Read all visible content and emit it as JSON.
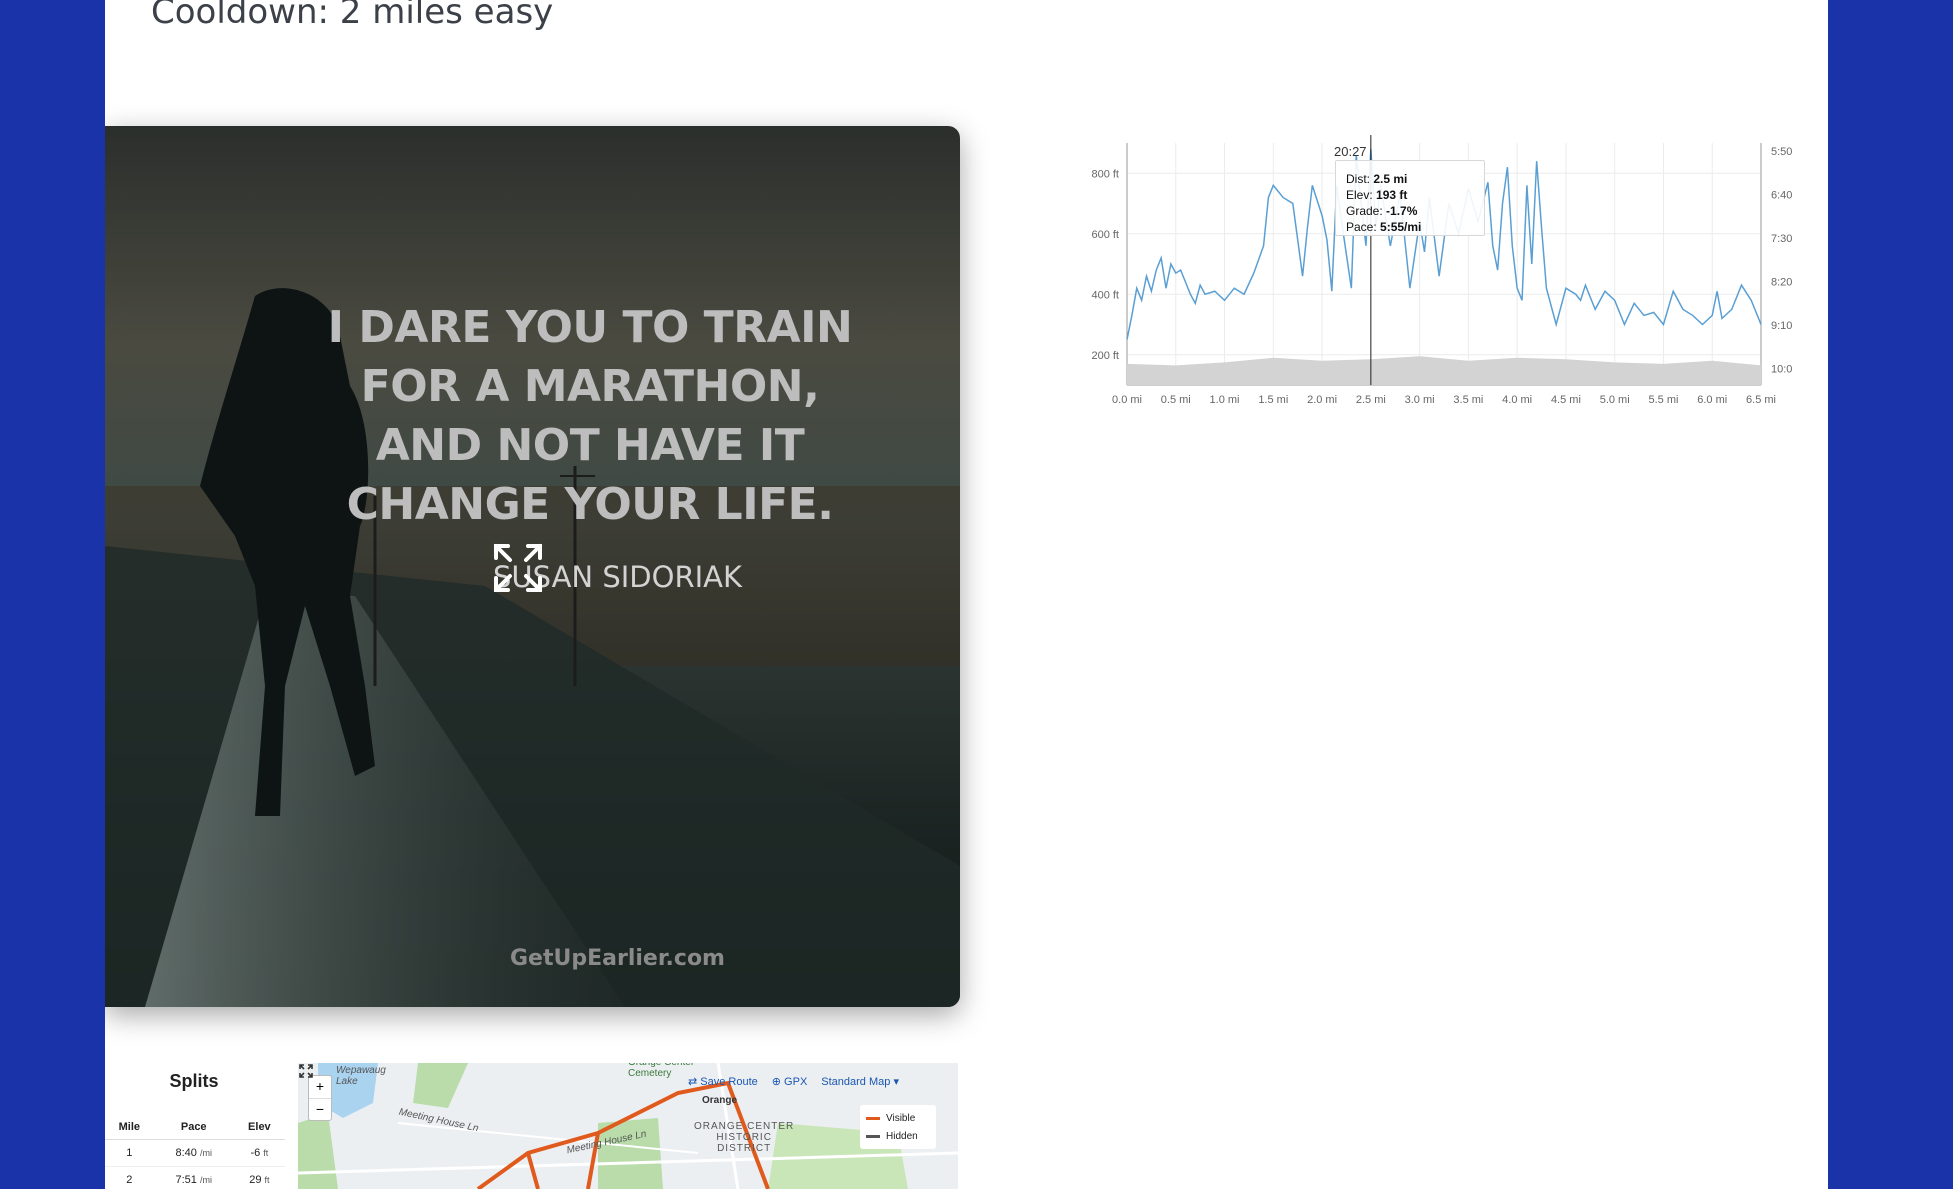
{
  "workout": {
    "cooldown": "Cooldown: 2 miles easy"
  },
  "poster": {
    "quote": "I DARE YOU TO TRAIN\nFOR A MARATHON,\nAND NOT HAVE IT\nCHANGE YOUR LIFE.",
    "author": "SUSAN SIDORIAK",
    "site": "GetUpEarlier.com",
    "expand_icon": "expand-arrows-icon"
  },
  "chart_data": {
    "type": "line",
    "xlabel": "",
    "ylabel": "",
    "x_ticks": [
      "0.0 mi",
      "0.5 mi",
      "1.0 mi",
      "1.5 mi",
      "2.0 mi",
      "2.5 mi",
      "3.0 mi",
      "3.5 mi",
      "4.0 mi",
      "4.5 mi",
      "5.0 mi",
      "5.5 mi",
      "6.0 mi",
      "6.5 mi"
    ],
    "y_ticks_left": [
      "200 ft",
      "400 ft",
      "600 ft",
      "800 ft"
    ],
    "y_ticks_right": [
      "5:50",
      "6:40",
      "7:30",
      "8:20",
      "9:10",
      "10:0"
    ],
    "xlim": [
      0,
      6.5
    ],
    "ylim": [
      100,
      900
    ],
    "grid": true,
    "series": [
      {
        "type": "line",
        "color": "#5a9fd4",
        "x": [
          0,
          0.05,
          0.1,
          0.15,
          0.2,
          0.25,
          0.3,
          0.35,
          0.4,
          0.45,
          0.5,
          0.55,
          0.6,
          0.65,
          0.7,
          0.75,
          0.8,
          0.9,
          1.0,
          1.1,
          1.2,
          1.3,
          1.4,
          1.45,
          1.5,
          1.55,
          1.6,
          1.7,
          1.8,
          1.85,
          1.9,
          2.0,
          2.05,
          2.1,
          2.15,
          2.2,
          2.3,
          2.35,
          2.4,
          2.45,
          2.5,
          2.55,
          2.6,
          2.7,
          2.8,
          2.9,
          3.0,
          3.05,
          3.1,
          3.2,
          3.3,
          3.4,
          3.5,
          3.6,
          3.7,
          3.75,
          3.8,
          3.85,
          3.9,
          3.95,
          4.0,
          4.05,
          4.1,
          4.15,
          4.2,
          4.25,
          4.3,
          4.4,
          4.5,
          4.6,
          4.65,
          4.7,
          4.8,
          4.9,
          5.0,
          5.1,
          5.2,
          5.3,
          5.4,
          5.5,
          5.6,
          5.7,
          5.8,
          5.9,
          6.0,
          6.05,
          6.1,
          6.2,
          6.3,
          6.4,
          6.5
        ],
        "y": [
          250,
          330,
          420,
          380,
          460,
          410,
          480,
          520,
          420,
          500,
          470,
          480,
          440,
          400,
          370,
          430,
          400,
          410,
          380,
          420,
          400,
          470,
          560,
          720,
          760,
          740,
          720,
          700,
          460,
          620,
          760,
          660,
          580,
          410,
          760,
          640,
          420,
          860,
          700,
          560,
          880,
          620,
          760,
          560,
          730,
          420,
          640,
          540,
          720,
          460,
          700,
          600,
          750,
          640,
          770,
          560,
          480,
          700,
          820,
          560,
          420,
          380,
          760,
          500,
          840,
          620,
          420,
          300,
          420,
          400,
          380,
          430,
          350,
          410,
          380,
          300,
          370,
          330,
          340,
          300,
          410,
          350,
          330,
          300,
          330,
          410,
          320,
          350,
          430,
          380,
          300
        ]
      }
    ],
    "elevation_area": {
      "color": "#d3d3d3",
      "x": [
        0,
        0.5,
        1.0,
        1.5,
        2.0,
        2.5,
        3.0,
        3.5,
        4.0,
        4.5,
        5.0,
        5.5,
        6.0,
        6.5
      ],
      "y": [
        170,
        165,
        175,
        190,
        180,
        185,
        195,
        180,
        190,
        185,
        175,
        170,
        180,
        165
      ]
    },
    "cursor": {
      "x": 2.5
    },
    "tooltip": {
      "time": "20:27",
      "dist_label": "Dist:",
      "dist": "2.5 mi",
      "elev_label": "Elev:",
      "elev": "193 ft",
      "grade_label": "Grade:",
      "grade": "-1.7%",
      "pace_label": "Pace:",
      "pace": "5:55/mi"
    }
  },
  "splits": {
    "title": "Splits",
    "headers": [
      "Mile",
      "Pace",
      "Elev"
    ],
    "rows": [
      {
        "mile": "1",
        "pace": "8:40",
        "pace_unit": "/mi",
        "elev": "-6",
        "elev_unit": "ft"
      },
      {
        "mile": "2",
        "pace": "7:51",
        "pace_unit": "/mi",
        "elev": "29",
        "elev_unit": "ft"
      }
    ]
  },
  "map": {
    "zoom_in": "+",
    "zoom_out": "−",
    "save_route": "Save Route",
    "gpx": "GPX",
    "map_style": "Standard Map",
    "legend_visible": "Visible",
    "legend_hidden": "Hidden",
    "route_color": "#e05a1e",
    "labels": {
      "lake": "Wepawaug\nLake",
      "road1": "Meeting House Ln",
      "road2": "Meeting House Ln",
      "cemetery": "Orange Center\nCemetery",
      "district": "ORANGE CENTER\nHISTORIC\nDISTRICT",
      "town": "Orange"
    }
  }
}
